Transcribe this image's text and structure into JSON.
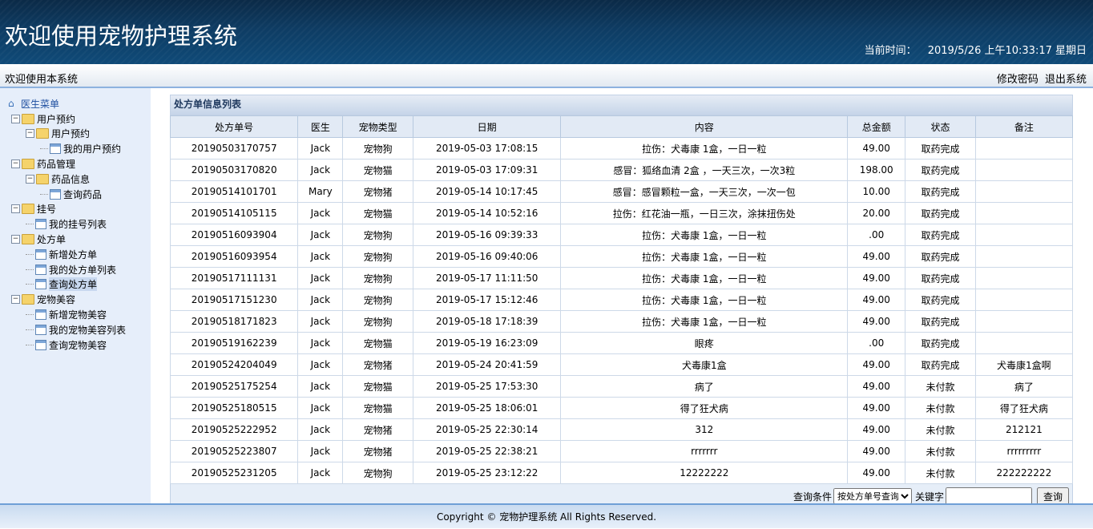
{
  "header": {
    "title": "欢迎使用宠物护理系统",
    "time_label": "当前时间：",
    "time_value": "2019/5/26 上午10:33:17 星期日"
  },
  "subbar": {
    "welcome": "欢迎使用本系统",
    "change_password": "修改密码",
    "logout": "退出系统"
  },
  "sidebar": {
    "root": "医生菜单",
    "items": [
      {
        "label": "用户预约",
        "level": 1,
        "type": "folder"
      },
      {
        "label": "用户预约",
        "level": 2,
        "type": "folder"
      },
      {
        "label": "我的用户预约",
        "level": 3,
        "type": "page"
      },
      {
        "label": "药品管理",
        "level": 1,
        "type": "folder"
      },
      {
        "label": "药品信息",
        "level": 2,
        "type": "folder"
      },
      {
        "label": "查询药品",
        "level": 3,
        "type": "page"
      },
      {
        "label": "挂号",
        "level": 1,
        "type": "folder"
      },
      {
        "label": "我的挂号列表",
        "level": 2,
        "type": "page"
      },
      {
        "label": "处方单",
        "level": 1,
        "type": "folder"
      },
      {
        "label": "新增处方单",
        "level": 2,
        "type": "page"
      },
      {
        "label": "我的处方单列表",
        "level": 2,
        "type": "page"
      },
      {
        "label": "查询处方单",
        "level": 2,
        "type": "page",
        "selected": true
      },
      {
        "label": "宠物美容",
        "level": 1,
        "type": "folder"
      },
      {
        "label": "新增宠物美容",
        "level": 2,
        "type": "page"
      },
      {
        "label": "我的宠物美容列表",
        "level": 2,
        "type": "page"
      },
      {
        "label": "查询宠物美容",
        "level": 2,
        "type": "page"
      }
    ]
  },
  "panel": {
    "title": "处方单信息列表",
    "columns": [
      "处方单号",
      "医生",
      "宠物类型",
      "日期",
      "内容",
      "总金额",
      "状态",
      "备注"
    ],
    "rows": [
      [
        "20190503170757",
        "Jack",
        "宠物狗",
        "2019-05-03 17:08:15",
        "拉伤：犬毒康 1盒，一日一粒",
        "49.00",
        "取药完成",
        ""
      ],
      [
        "20190503170820",
        "Jack",
        "宠物猫",
        "2019-05-03 17:09:31",
        "感冒：狐络血清 2盒 ，一天三次，一次3粒",
        "198.00",
        "取药完成",
        ""
      ],
      [
        "20190514101701",
        "Mary",
        "宠物猪",
        "2019-05-14 10:17:45",
        "感冒：感冒颗粒一盒，一天三次，一次一包",
        "10.00",
        "取药完成",
        ""
      ],
      [
        "20190514105115",
        "Jack",
        "宠物猫",
        "2019-05-14 10:52:16",
        "拉伤：红花油一瓶，一日三次，涂抹扭伤处",
        "20.00",
        "取药完成",
        ""
      ],
      [
        "20190516093904",
        "Jack",
        "宠物狗",
        "2019-05-16 09:39:33",
        "拉伤：犬毒康 1盒，一日一粒",
        ".00",
        "取药完成",
        ""
      ],
      [
        "20190516093954",
        "Jack",
        "宠物狗",
        "2019-05-16 09:40:06",
        "拉伤：犬毒康 1盒，一日一粒",
        "49.00",
        "取药完成",
        ""
      ],
      [
        "20190517111131",
        "Jack",
        "宠物狗",
        "2019-05-17 11:11:50",
        "拉伤：犬毒康 1盒，一日一粒",
        "49.00",
        "取药完成",
        ""
      ],
      [
        "20190517151230",
        "Jack",
        "宠物狗",
        "2019-05-17 15:12:46",
        "拉伤：犬毒康 1盒，一日一粒",
        "49.00",
        "取药完成",
        ""
      ],
      [
        "20190518171823",
        "Jack",
        "宠物狗",
        "2019-05-18 17:18:39",
        "拉伤：犬毒康 1盒，一日一粒",
        "49.00",
        "取药完成",
        ""
      ],
      [
        "20190519162239",
        "Jack",
        "宠物猫",
        "2019-05-19 16:23:09",
        "眼疼",
        ".00",
        "取药完成",
        ""
      ],
      [
        "20190524204049",
        "Jack",
        "宠物猪",
        "2019-05-24 20:41:59",
        "犬毒康1盒",
        "49.00",
        "取药完成",
        "犬毒康1盒啊"
      ],
      [
        "20190525175254",
        "Jack",
        "宠物猫",
        "2019-05-25 17:53:30",
        "病了",
        "49.00",
        "未付款",
        "病了"
      ],
      [
        "20190525180515",
        "Jack",
        "宠物猫",
        "2019-05-25 18:06:01",
        "得了狂犬病",
        "49.00",
        "未付款",
        "得了狂犬病"
      ],
      [
        "20190525222952",
        "Jack",
        "宠物猪",
        "2019-05-25 22:30:14",
        "312",
        "49.00",
        "未付款",
        "212121"
      ],
      [
        "20190525223807",
        "Jack",
        "宠物猪",
        "2019-05-25 22:38:21",
        "rrrrrrr",
        "49.00",
        "未付款",
        "rrrrrrrrr"
      ],
      [
        "20190525231205",
        "Jack",
        "宠物狗",
        "2019-05-25 23:12:22",
        "12222222",
        "49.00",
        "未付款",
        "222222222"
      ]
    ]
  },
  "query": {
    "label": "查询条件",
    "select_value": "按处方单号查询",
    "keyword_label": "关键字",
    "keyword_value": "",
    "button": "查询"
  },
  "footer": {
    "copyright": "Copyright © 宠物护理系统 All Rights Reserved."
  }
}
